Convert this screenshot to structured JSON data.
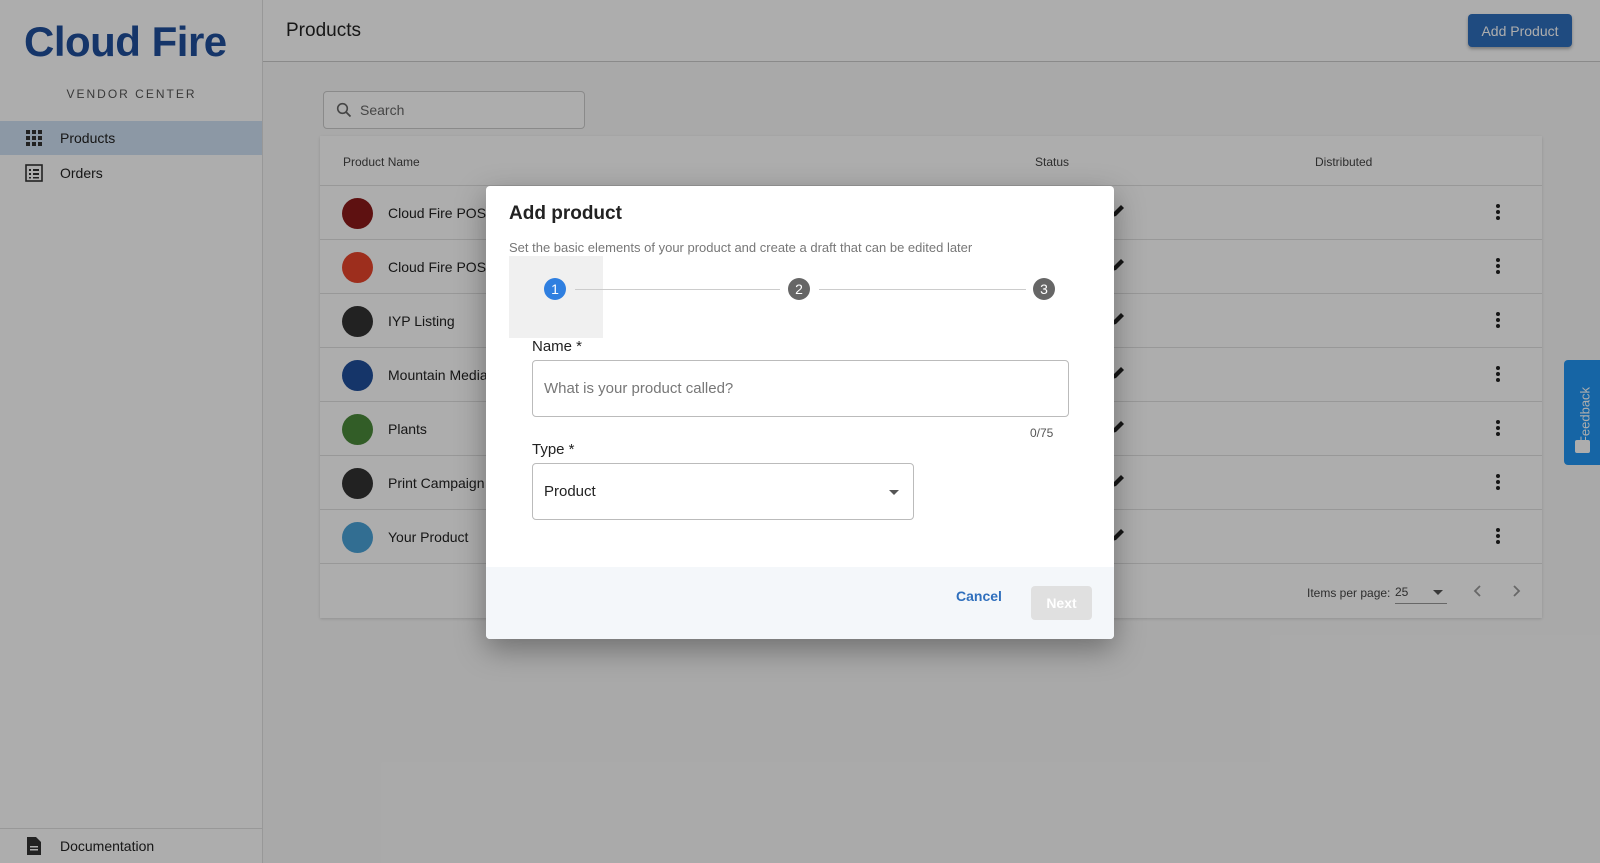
{
  "app": {
    "logo_text": "Cloud Fire",
    "subtitle": "VENDOR CENTER"
  },
  "sidebar": {
    "items": [
      {
        "label": "Products",
        "icon": "grid-icon",
        "active": true
      },
      {
        "label": "Orders",
        "icon": "list-icon",
        "active": false
      }
    ],
    "footer": {
      "label": "Documentation",
      "icon": "document-icon"
    }
  },
  "header": {
    "title": "Products",
    "add_button": "Add Product"
  },
  "search": {
    "placeholder": "Search"
  },
  "table": {
    "columns": [
      "Product Name",
      "Status",
      "Distributed"
    ],
    "rows": [
      {
        "name": "Cloud Fire POS S",
        "thumb_color": "#8b1a1a"
      },
      {
        "name": "Cloud Fire POS S",
        "thumb_color": "#e8452c"
      },
      {
        "name": "IYP Listing",
        "thumb_color": "#333333"
      },
      {
        "name": "Mountain Media",
        "thumb_color": "#1f4e9b"
      },
      {
        "name": "Plants",
        "thumb_color": "#4a8a3a"
      },
      {
        "name": "Print Campaign",
        "thumb_color": "#333333"
      },
      {
        "name": "Your Product",
        "thumb_color": "#4aa3d8"
      }
    ],
    "items_per_page_label": "Items per page:",
    "items_per_page": "25"
  },
  "feedback": {
    "label": "Feedback"
  },
  "dialog": {
    "title": "Add product",
    "subtitle": "Set the basic elements of your product and create a draft that can be edited later",
    "steps": [
      "1",
      "2",
      "3"
    ],
    "active_step": 1,
    "name_label": "Name *",
    "name_placeholder": "What is your product called?",
    "name_value": "",
    "name_counter": "0/75",
    "type_label": "Type *",
    "type_value": "Product",
    "cancel": "Cancel",
    "next": "Next"
  },
  "colors": {
    "accent": "#2f6fbd",
    "step_active": "#2f7fe0",
    "brand": "#1f4e9b",
    "flame": "#e8452c"
  }
}
